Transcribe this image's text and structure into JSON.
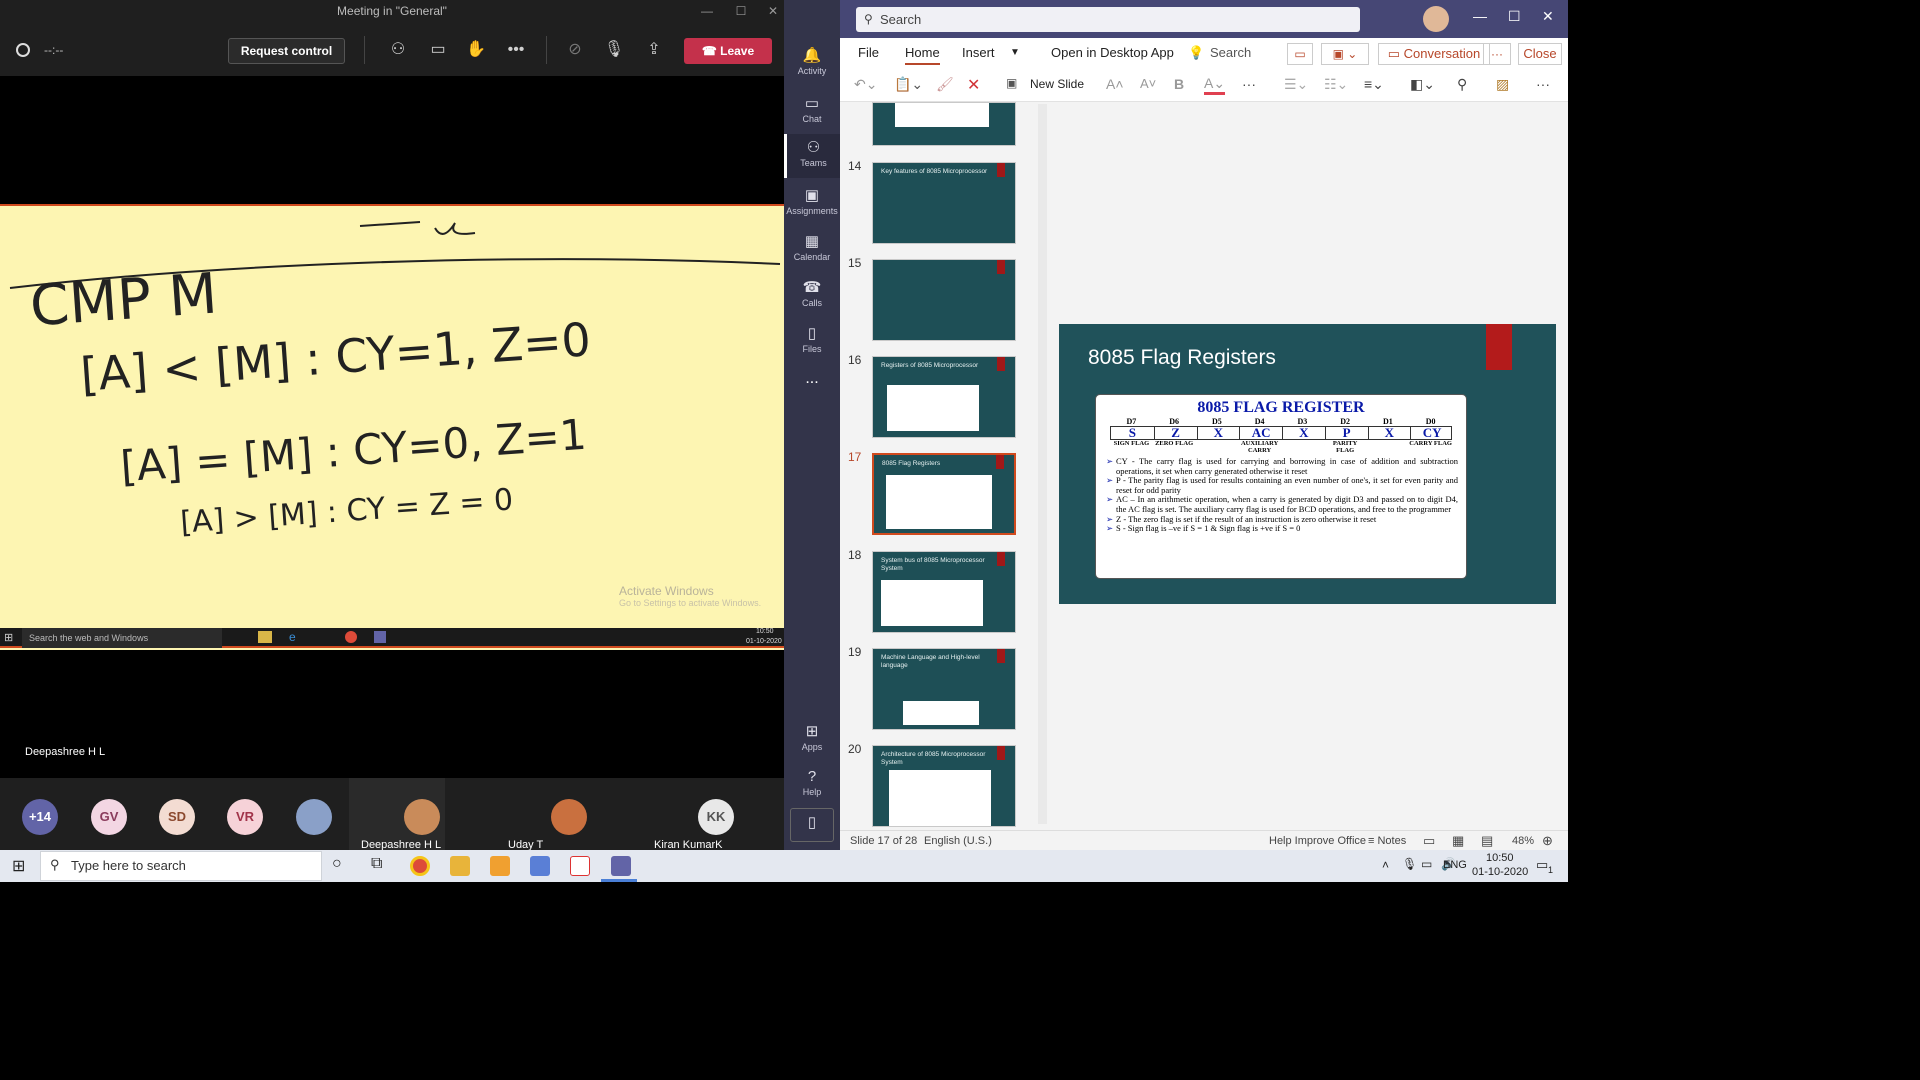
{
  "meeting": {
    "title": "Meeting in \"General\"",
    "timer": "--:--",
    "request_control": "Request control",
    "leave": "Leave",
    "presenter": "Deepashree H L",
    "watermark_line1": "Activate Windows",
    "watermark_line2": "Go to Settings to activate Windows.",
    "remote_search": "Search the web and Windows",
    "remote_time": "10:50",
    "remote_date": "01-10-2020"
  },
  "whiteboard": {
    "line1": "CMP  M",
    "line2": "[A] < [M] :  CY=1, Z=0",
    "line3": "[A] = [M] :  CY=0, Z=1",
    "line4": "[A] > [M] :  CY = Z = 0"
  },
  "participants": [
    {
      "initials": "+14",
      "color": "#6264a7"
    },
    {
      "initials": "GV",
      "color": "#f3d6e3"
    },
    {
      "initials": "SD",
      "color": "#f3dcd2"
    },
    {
      "initials": "VR",
      "color": "#f6d2d8"
    }
  ],
  "participant_names": {
    "p1": "Deepashree H L",
    "p2": "Uday T",
    "p3": "Kiran KumarK",
    "p3_initials": "KK"
  },
  "rail": [
    {
      "label": "Activity",
      "icon": "bell-icon"
    },
    {
      "label": "Chat",
      "icon": "chat-icon"
    },
    {
      "label": "Teams",
      "icon": "teams-icon"
    },
    {
      "label": "Assignments",
      "icon": "assignments-icon"
    },
    {
      "label": "Calendar",
      "icon": "calendar-icon"
    },
    {
      "label": "Calls",
      "icon": "phone-icon"
    },
    {
      "label": "Files",
      "icon": "file-icon"
    },
    {
      "label": "...",
      "icon": "more-icon"
    },
    {
      "label": "Apps",
      "icon": "apps-icon"
    },
    {
      "label": "Help",
      "icon": "help-icon"
    }
  ],
  "search": {
    "placeholder": "Search"
  },
  "ribbon": {
    "file": "File",
    "home": "Home",
    "insert": "Insert",
    "open_desktop": "Open in Desktop App",
    "search": "Search",
    "conversation": "Conversation",
    "more": "···",
    "close": "Close",
    "new_slide": "New Slide"
  },
  "slides": [
    {
      "num": "14",
      "title": "Key features of 8085 Microprocessor"
    },
    {
      "num": "15",
      "title": ""
    },
    {
      "num": "16",
      "title": "Registers of 8085 Microprocessor"
    },
    {
      "num": "17",
      "title": "8085 Flag Registers"
    },
    {
      "num": "18",
      "title": "System bus of 8085 Microprocessor System"
    },
    {
      "num": "19",
      "title": "Machine Language and High-level language"
    },
    {
      "num": "20",
      "title": "Architecture of 8085 Microprocessor System"
    }
  ],
  "main_slide": {
    "title": "8085 Flag Registers",
    "box_title": "8085 FLAG REGISTER",
    "bits": [
      "D7",
      "D6",
      "D5",
      "D4",
      "D3",
      "D2",
      "D1",
      "D0"
    ],
    "flags": [
      "S",
      "Z",
      "X",
      "AC",
      "X",
      "P",
      "X",
      "CY"
    ],
    "flag_names": [
      "SIGN FLAG",
      "ZERO FLAG",
      "",
      "AUXILIARY CARRY",
      "",
      "PARITY FLAG",
      "",
      "CARRY FLAG"
    ],
    "points": [
      "CY - The carry flag is used for carrying and borrowing in case of addition and subtraction operations, it set when carry generated otherwise it reset",
      "P - The parity flag is used for results containing an even number of one's, it set for even parity and reset for odd parity",
      "AC – In an arithmetic operation, when a carry is generated by digit D3 and passed on to digit D4, the AC flag is set. The auxiliary carry flag is used for BCD operations, and free to the programmer",
      "Z - The zero flag is set if the result of an instruction is zero otherwise it reset",
      "S - Sign flag is –ve if S = 1 & Sign flag is +ve if S = 0"
    ]
  },
  "status": {
    "slide": "Slide 17 of 28",
    "language": "English (U.S.)",
    "help": "Help Improve Office",
    "notes": "Notes",
    "zoom": "48%"
  },
  "taskbar": {
    "search": "Type here to search",
    "lang": "ENG",
    "time": "10:50",
    "date": "01-10-2020",
    "notif": "1"
  }
}
